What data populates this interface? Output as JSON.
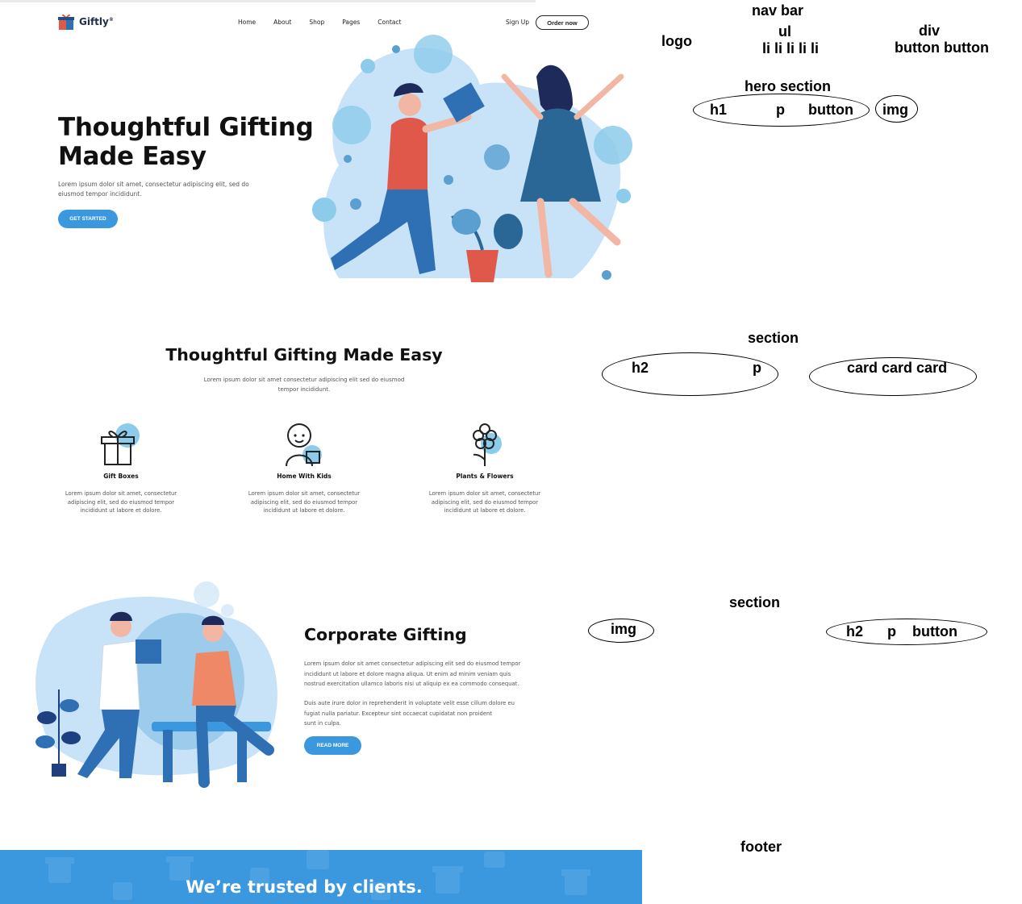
{
  "brand": {
    "name": "Giftly",
    "mark": "®"
  },
  "nav": {
    "items": [
      "Home",
      "About",
      "Shop",
      "Pages",
      "Contact"
    ],
    "signup": "Sign Up",
    "order": "Order now"
  },
  "hero": {
    "title_line1": "Thoughtful Gifting",
    "title_line2": "Made Easy",
    "text_line1": "Lorem ipsum dolor sit amet, consectetur adipiscing elit, sed do",
    "text_line2": "eiusmod tempor incididunt.",
    "button": "GET STARTED"
  },
  "features": {
    "title": "Thoughtful Gifting Made Easy",
    "text_line1": "Lorem ipsum dolor sit amet consectetur adipiscing elit sed do eiusmod",
    "text_line2": "tempor incididunt.",
    "cards": [
      {
        "icon": "gift-box-icon",
        "title": "Gift Boxes",
        "text_line1": "Lorem ipsum dolor sit amet, consectetur",
        "text_line2": "adipiscing elit, sed do eiusmod tempor",
        "text_line3": "incididunt ut labore et dolore."
      },
      {
        "icon": "kid-with-gift-icon",
        "title": "Home With Kids",
        "text_line1": "Lorem ipsum dolor sit amet, consectetur",
        "text_line2": "adipiscing elit, sed do eiusmod tempor",
        "text_line3": "incididunt ut labore et dolore."
      },
      {
        "icon": "flower-icon",
        "title": "Plants & Flowers",
        "text_line1": "Lorem ipsum dolor sit amet, consectetur",
        "text_line2": "adipiscing elit, sed do eiusmod tempor",
        "text_line3": "incididunt ut labore et dolore."
      }
    ]
  },
  "corporate": {
    "title": "Corporate Gifting",
    "para1_line1": "Lorem ipsum dolor sit amet consectetur adipiscing elit sed do eiusmod tempor",
    "para1_line2": "incididunt ut labore et dolore magna aliqua. Ut enim ad minim veniam quis",
    "para1_line3": "nostrud exercitation ullamco laboris nisi ut aliquip ex ea commodo consequat.",
    "para2_line1": "Duis aute irure dolor in reprehenderit in voluptate velit esse cillum dolore eu",
    "para2_line2": "fugiat nulla pariatur. Excepteur sint occaecat cupidatat non proident",
    "para2_line3": "sunt in culpa.",
    "button": "READ MORE"
  },
  "footer": {
    "title": "We’re trusted by clients."
  },
  "annotations": {
    "navbar": "nav bar",
    "logo": "logo",
    "ul": "ul",
    "li": "li li li li li",
    "div": "div",
    "buttons": "button button",
    "hero": "hero section",
    "h1": "h1",
    "p": "p",
    "button": "button",
    "img": "img",
    "section": "section",
    "h2": "h2",
    "cards": "card card card",
    "footer": "footer"
  },
  "colors": {
    "accent": "#3b97de",
    "dark": "#111111",
    "illustration_blue": "#c6e2f7",
    "illustration_red": "#e0584a"
  }
}
